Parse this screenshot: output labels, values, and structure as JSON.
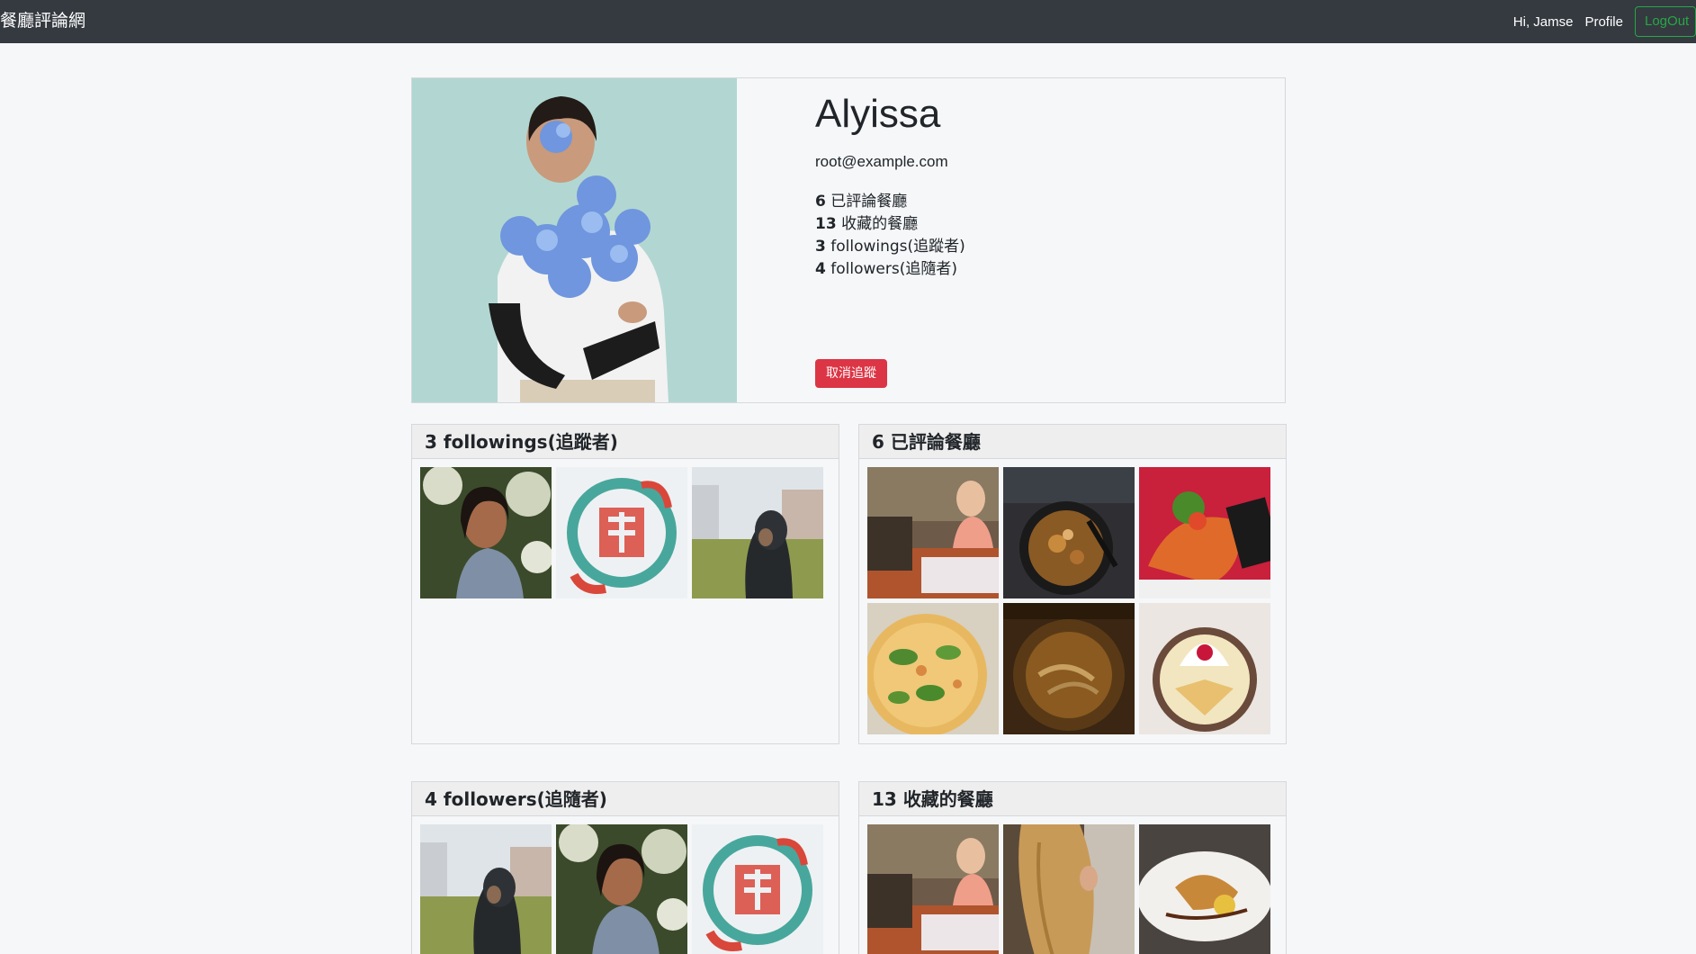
{
  "navbar": {
    "brand": "餐廳評論網",
    "greeting": "Hi, Jamse",
    "profile_link": "Profile",
    "logout_label": "LogOut"
  },
  "profile": {
    "name": "Alyissa",
    "email": "root@example.com",
    "stats": [
      {
        "count": "6",
        "label": "已評論餐廳"
      },
      {
        "count": "13",
        "label": "收藏的餐廳"
      },
      {
        "count": "3",
        "label": "followings(追蹤者)"
      },
      {
        "count": "4",
        "label": "followers(追隨者)"
      }
    ],
    "unfollow_label": "取消追蹤"
  },
  "panels": {
    "followings": {
      "count": "3",
      "title": "followings(追蹤者)"
    },
    "commented": {
      "count": "6",
      "title": "已評論餐廳"
    },
    "followers": {
      "count": "4",
      "title": "followers(追隨者)"
    },
    "favorited": {
      "count": "13",
      "title": "收藏的餐廳"
    }
  }
}
